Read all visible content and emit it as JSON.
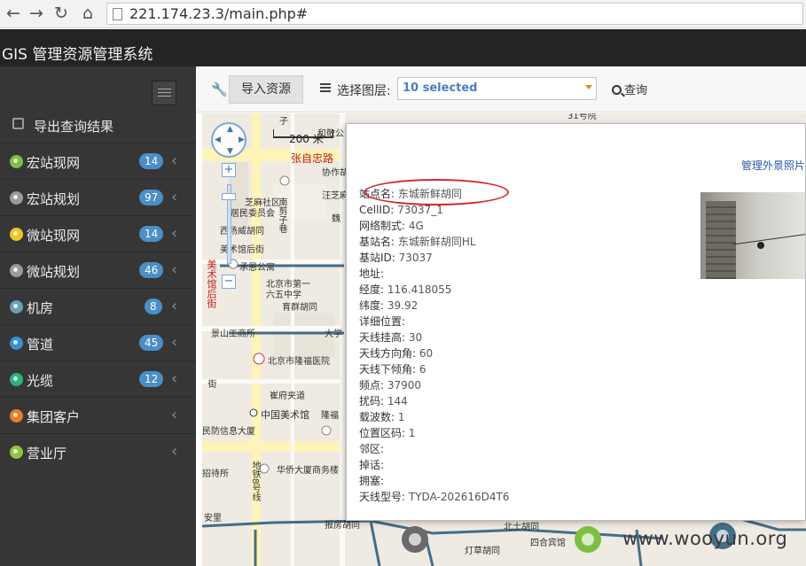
{
  "browser": {
    "back_icon": "arrow-left",
    "forward_icon": "arrow-right",
    "reload_icon": "reload",
    "home_icon": "home",
    "url": "221.174.23.3/main.php#"
  },
  "app": {
    "title": "GIS 管理资源管理系统"
  },
  "sidebar": {
    "export_label": "导出查询结果",
    "items": [
      {
        "label": "宏站现网",
        "badge": "14",
        "icon_color": "#7cc043"
      },
      {
        "label": "宏站规划",
        "badge": "97",
        "icon_color": "#9b9b9b"
      },
      {
        "label": "微站现网",
        "badge": "14",
        "icon_color": "#f0c420"
      },
      {
        "label": "微站规划",
        "badge": "46",
        "icon_color": "#9b9b9b"
      },
      {
        "label": "机房",
        "badge": "8",
        "icon_color": "#6a9fb5"
      },
      {
        "label": "管道",
        "badge": "45",
        "icon_color": "#3a8fd8"
      },
      {
        "label": "光缆",
        "badge": "12",
        "icon_color": "#2ab37a"
      },
      {
        "label": "集团客户",
        "badge": "",
        "icon_color": "#e87d2a"
      },
      {
        "label": "营业厅",
        "badge": "",
        "icon_color": "#8cc63f"
      }
    ]
  },
  "toolbar": {
    "import_label": "导入资源",
    "layer_label": "选择图层:",
    "layer_value": "10 selected",
    "query_label": "查询"
  },
  "map": {
    "scale_label": "200 米",
    "labels": {
      "road_zhangzizhong": "张自忠路",
      "xiehe": "协作胡",
      "wangzhi": "汪芝麻",
      "zhimacommunity": "芝麻社区",
      "residents": "居民委员会",
      "nanjianzi": "南剪子巷",
      "weilian": "魏",
      "xiweihutong": "西扬威胡同",
      "meishuguan_back": "美术馆后街",
      "chengen": "承恩公寓",
      "beijing_school": "北京市第一",
      "sixth_school": "六五中学",
      "yuqun": "育群胡同",
      "meishuguan_vert": "美术馆后街",
      "jingshan": "景山工商所",
      "dadalu": "大学",
      "longfu": "北京市隆福医院",
      "jie": "街",
      "cuifu": "崔府夹道",
      "meishuguan": "中国美术馆",
      "longfu2": "隆福",
      "minfang": "民防信息大厦",
      "tielu": "地铁8号线",
      "zhaodai": "招待所",
      "huaqiao": "华侨大厦商务楼",
      "anli": "安里",
      "baofang": "报房胡同",
      "chihuo": "北士胡同",
      "siheyuan": "四合宾馆",
      "dengcao": "灯草胡同",
      "top_no31": "31号院",
      "top_hejingong": "和敬公",
      "top_zi": "子"
    }
  },
  "popup": {
    "manage_link": "管理外景照片",
    "attributes": [
      {
        "key": "站点名",
        "value": "东城新鲜胡同"
      },
      {
        "key": "CellID",
        "value": "73037_1"
      },
      {
        "key": "网络制式",
        "value": "4G"
      },
      {
        "key": "基站名",
        "value": "东城新鲜胡同HL"
      },
      {
        "key": "基站ID",
        "value": "73037"
      },
      {
        "key": "地址",
        "value": ""
      },
      {
        "key": "经度",
        "value": "116.418055"
      },
      {
        "key": "纬度",
        "value": "39.92"
      },
      {
        "key": "详细位置",
        "value": ""
      },
      {
        "key": "天线挂高",
        "value": "30"
      },
      {
        "key": "天线方向角",
        "value": "60"
      },
      {
        "key": "天线下倾角",
        "value": "6"
      },
      {
        "key": "频点",
        "value": "37900"
      },
      {
        "key": "扰码",
        "value": "144"
      },
      {
        "key": "载波数",
        "value": "1"
      },
      {
        "key": "位置区码",
        "value": "1"
      },
      {
        "key": "邻区",
        "value": ""
      },
      {
        "key": "掉话",
        "value": ""
      },
      {
        "key": "拥塞",
        "value": ""
      },
      {
        "key": "天线型号",
        "value": "TYDA-202616D4T6"
      }
    ]
  },
  "watermark": "www.wooyun.org"
}
